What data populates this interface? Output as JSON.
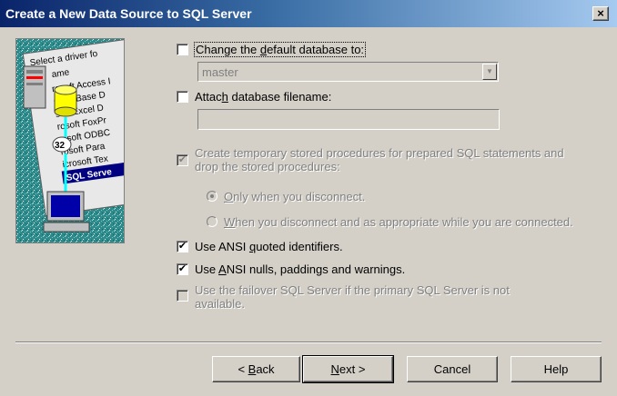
{
  "window": {
    "title": "Create a New Data Source to SQL Server",
    "close_glyph": "×"
  },
  "illustration": {
    "list_header": "Select a driver fo",
    "name_header": "ame",
    "drivers": [
      "rosoft Access I",
      "soft dBase D",
      "soft Excel D",
      "rosoft FoxPr",
      "rosoft ODBC",
      "rosoft Para",
      "icrosoft Tex"
    ],
    "selected_driver": "SQL Serve",
    "badge": "32",
    "colors": {
      "teal": "#2e8b8b",
      "selected_bg": "#000080",
      "cylinder": "#ffff00",
      "screen": "#0000a8"
    }
  },
  "options": {
    "change_default_db": {
      "label_pre": "Change the ",
      "label_key": "d",
      "label_post": "efault database to:",
      "checked": false
    },
    "default_db_combo": {
      "value": "master",
      "enabled": false
    },
    "attach_db": {
      "label_pre": "Attac",
      "label_key": "h",
      "label_post": " database filename:",
      "checked": false
    },
    "attach_db_field": {
      "value": ""
    },
    "temp_procs": {
      "label": "Create temporary stored procedures for prepared SQL statements and drop the stored procedures:",
      "checked": true,
      "enabled": false
    },
    "radio_disconnect": {
      "label_key": "O",
      "label_post": "nly when you disconnect.",
      "selected": true
    },
    "radio_appropriate": {
      "label_key": "W",
      "label_post": "hen you disconnect and as appropriate while you are connected.",
      "selected": false
    },
    "ansi_quoted": {
      "label_pre": "Use ANSI ",
      "label_key": "q",
      "label_post": "uoted identifiers.",
      "checked": true
    },
    "ansi_nulls": {
      "label_pre": "Use ",
      "label_key": "A",
      "label_post": "NSI nulls, paddings and warnings.",
      "checked": true
    },
    "failover": {
      "label": "Use the failover SQL Server if the primary SQL Server is not available.",
      "checked": false,
      "enabled": false
    }
  },
  "buttons": {
    "back": {
      "pre": "< ",
      "key": "B",
      "post": "ack"
    },
    "next": {
      "pre": "",
      "key": "N",
      "post": "ext >"
    },
    "cancel": "Cancel",
    "help": "Help"
  },
  "check_glyph": "✔"
}
